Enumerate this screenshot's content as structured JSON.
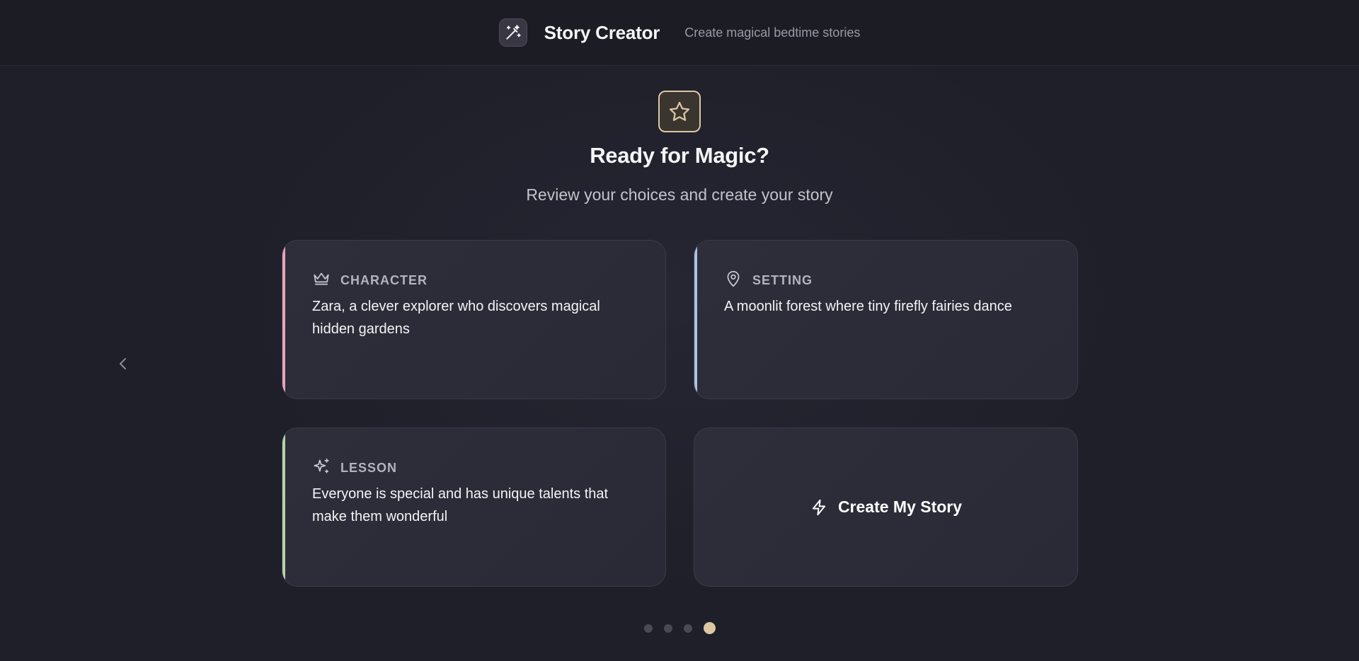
{
  "header": {
    "title": "Story Creator",
    "tagline": "Create magical bedtime stories",
    "logo_icon": "magic-wand-icon"
  },
  "hero": {
    "icon": "star-icon",
    "title": "Ready for Magic?",
    "subtitle": "Review your choices and create your story"
  },
  "cards": {
    "character": {
      "icon": "crown-icon",
      "label": "CHARACTER",
      "text": "Zara, a clever explorer who discovers magical hidden gardens",
      "accent": "#e8a5b8"
    },
    "setting": {
      "icon": "map-pin-icon",
      "label": "SETTING",
      "text": "A moonlit forest where tiny firefly fairies dance",
      "accent": "#a8c4e6"
    },
    "lesson": {
      "icon": "sparkles-icon",
      "label": "LESSON",
      "text": "Everyone is special and has unique talents that make them wonderful",
      "accent": "#b6d3a8"
    }
  },
  "create_button": {
    "icon": "lightning-icon",
    "label": "Create My Story"
  },
  "navigation": {
    "prev_icon": "chevron-left-icon",
    "steps": 4,
    "active_step": 4
  },
  "colors": {
    "background": "#1f1f29",
    "card": "#2e2e3b",
    "gold_accent": "#dcc7a3"
  }
}
